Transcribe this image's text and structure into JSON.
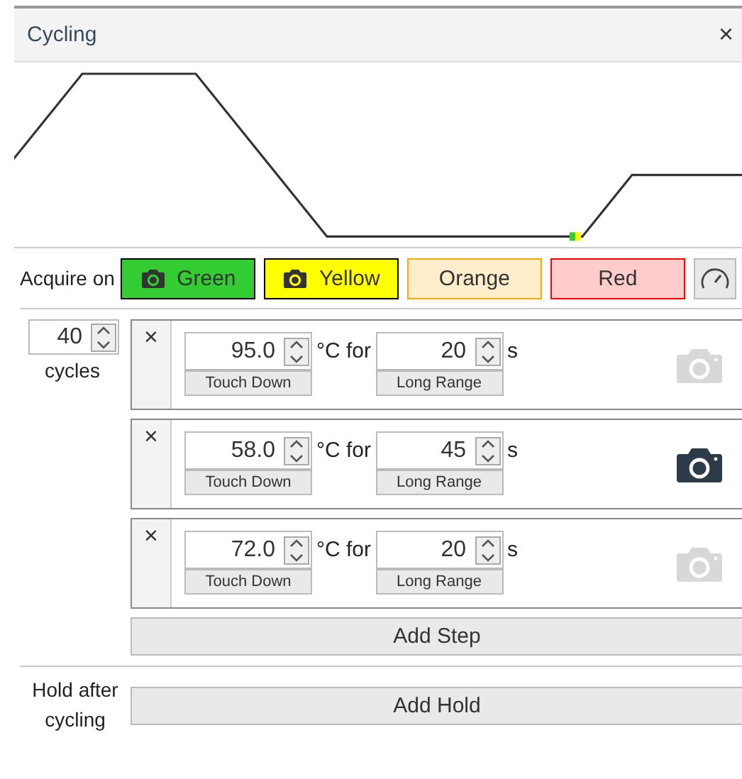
{
  "window": {
    "title": "Cycling",
    "close": "×"
  },
  "acquire": {
    "label": "Acquire on",
    "channels": [
      {
        "name": "Green",
        "selected": true,
        "color": "#33cc33"
      },
      {
        "name": "Yellow",
        "selected": true,
        "color": "#ffff00"
      },
      {
        "name": "Orange",
        "selected": false,
        "color": "#ffa500"
      },
      {
        "name": "Red",
        "selected": false,
        "color": "#ff0000"
      }
    ]
  },
  "cycling": {
    "cycles": "40",
    "cycles_label": "cycles",
    "steps": [
      {
        "remove": "×",
        "temperature": "95.0",
        "temperature_mode": "Touch Down",
        "for_label": "°C for",
        "duration": "20",
        "duration_mode": "Long Range",
        "unit": "s",
        "acquire": false
      },
      {
        "remove": "×",
        "temperature": "58.0",
        "temperature_mode": "Touch Down",
        "for_label": "°C for",
        "duration": "45",
        "duration_mode": "Long Range",
        "unit": "s",
        "acquire": true
      },
      {
        "remove": "×",
        "temperature": "72.0",
        "temperature_mode": "Touch Down",
        "for_label": "°C for",
        "duration": "20",
        "duration_mode": "Long Range",
        "unit": "s",
        "acquire": false
      }
    ],
    "add_step": "Add Step"
  },
  "hold": {
    "label": "Hold after cycling",
    "add_hold": "Add Hold"
  }
}
